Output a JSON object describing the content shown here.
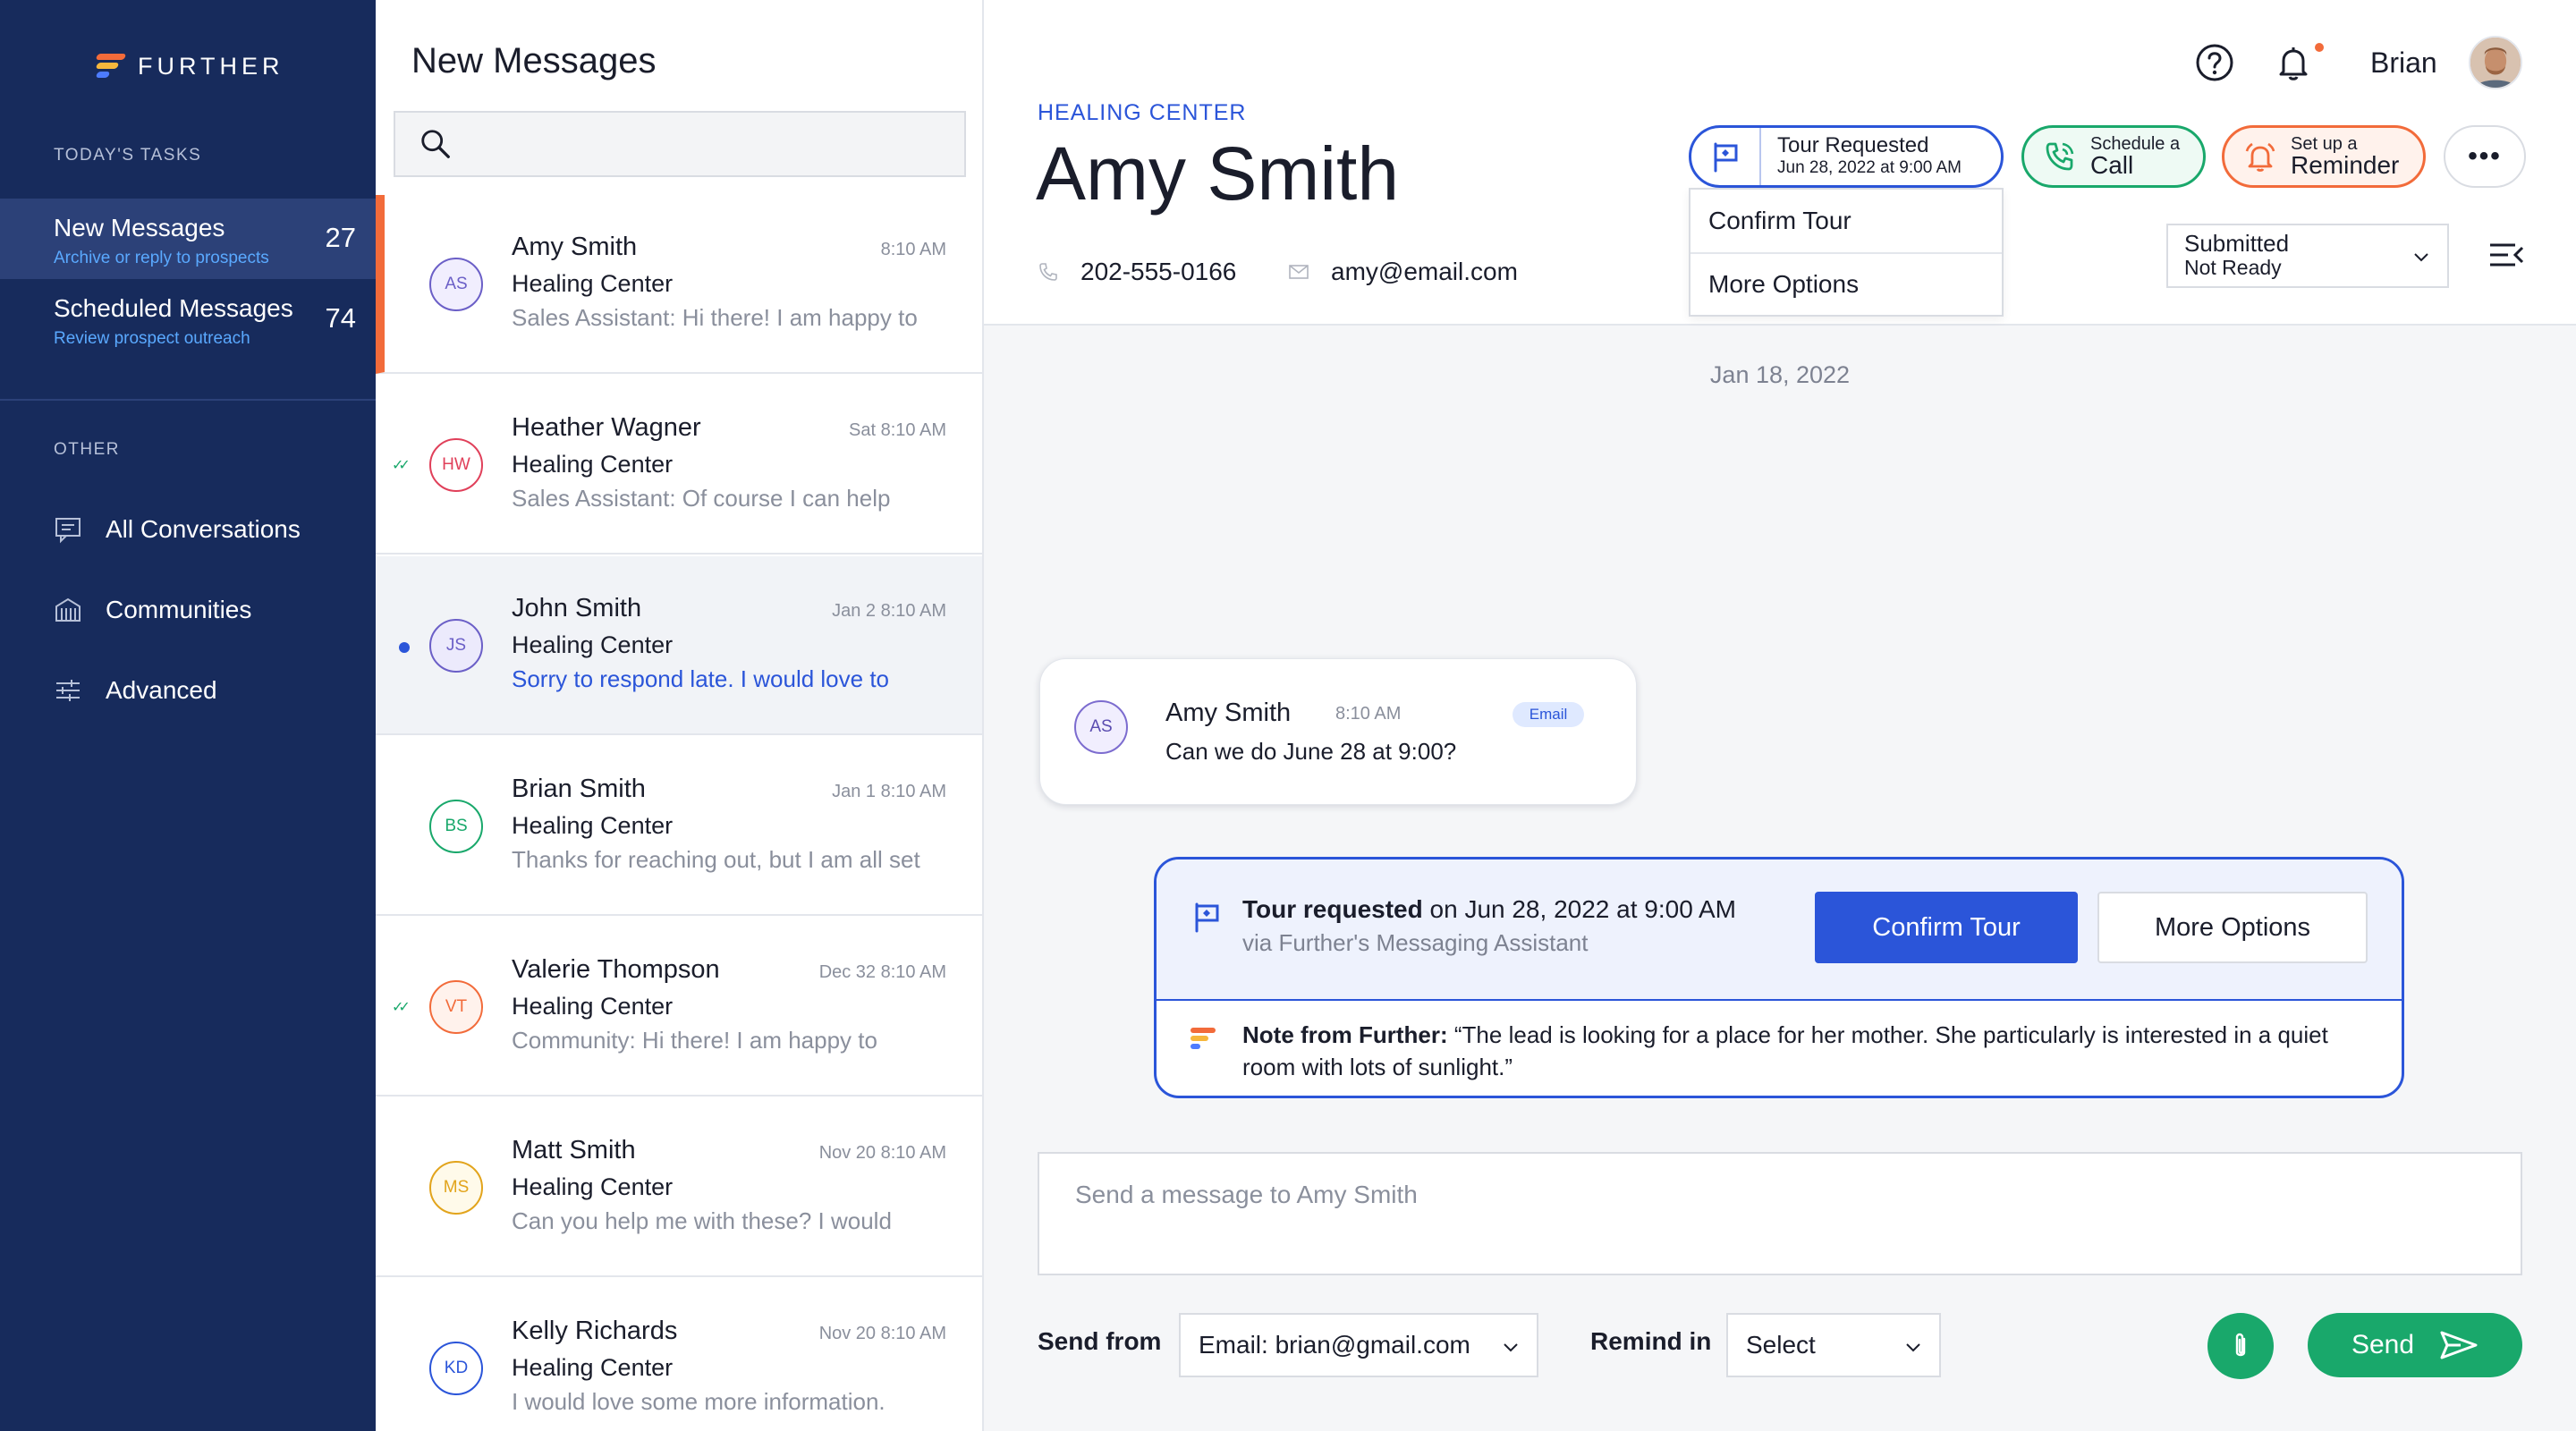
{
  "brand": {
    "name": "FURTHER"
  },
  "sidebar": {
    "todays_tasks_heading": "TODAY'S TASKS",
    "tasks": [
      {
        "title": "New Messages",
        "subtitle": "Archive or reply to prospects",
        "count": "27",
        "active": true
      },
      {
        "title": "Scheduled Messages",
        "subtitle": "Review prospect outreach",
        "count": "74",
        "active": false
      }
    ],
    "other_heading": "OTHER",
    "nav": [
      {
        "label": "All Conversations",
        "icon": "chat-icon"
      },
      {
        "label": "Communities",
        "icon": "building-icon"
      },
      {
        "label": "Advanced",
        "icon": "sliders-icon"
      }
    ]
  },
  "list": {
    "title": "New Messages",
    "search_placeholder": "",
    "conversations": [
      {
        "initials": "AS",
        "name": "Amy Smith",
        "org": "Healing Center",
        "preview": "Sales Assistant: Hi there! I am happy to",
        "time": "8:10 AM",
        "color": "#6b5fc7",
        "bg": "#f1eefe",
        "state": "selected"
      },
      {
        "initials": "HW",
        "name": "Heather Wagner",
        "org": "Healing Center",
        "preview": "Sales Assistant: Of course I can help",
        "time": "Sat 8:10 AM",
        "color": "#e0405a",
        "bg": "#ffffff",
        "state": "replied"
      },
      {
        "initials": "JS",
        "name": "John Smith",
        "org": "Healing Center",
        "preview": "Sorry to respond late. I would love to",
        "time": "Jan 2 8:10 AM",
        "color": "#6b5fc7",
        "bg": "#eceafc",
        "state": "unread"
      },
      {
        "initials": "BS",
        "name": "Brian Smith",
        "org": "Healing Center",
        "preview": "Thanks for reaching out, but I am all set",
        "time": "Jan 1 8:10 AM",
        "color": "#19a86b",
        "bg": "#ffffff",
        "state": "normal"
      },
      {
        "initials": "VT",
        "name": "Valerie Thompson",
        "org": "Healing Center",
        "preview": "Community: Hi there! I am happy to",
        "time": "Dec 32 8:10 AM",
        "color": "#f26b3a",
        "bg": "#fff2ec",
        "state": "replied"
      },
      {
        "initials": "MS",
        "name": "Matt Smith",
        "org": "Healing Center",
        "preview": "Can you help me with these? I would",
        "time": "Nov 20 8:10 AM",
        "color": "#e2a41c",
        "bg": "#fffaea",
        "state": "normal"
      },
      {
        "initials": "KD",
        "name": "Kelly Richards",
        "org": "Healing Center",
        "preview": "I would love some more information.",
        "time": "Nov 20 8:10 AM",
        "color": "#2b55d9",
        "bg": "#ffffff",
        "state": "normal"
      }
    ]
  },
  "header": {
    "org": "HEALING CENTER",
    "contact_name": "Amy Smith",
    "phone": "202-555-0166",
    "email": "amy@email.com",
    "user_name": "Brian",
    "tour": {
      "title": "Tour Requested",
      "date": "Jun 28, 2022 at 9:00 AM"
    },
    "tour_menu": [
      "Confirm Tour",
      "More Options"
    ],
    "call": {
      "small": "Schedule a",
      "big": "Call"
    },
    "reminder": {
      "small": "Set up a",
      "big": "Reminder"
    },
    "more": "•••",
    "status": {
      "line1": "Submitted",
      "line2": "Not Ready"
    }
  },
  "thread": {
    "date": "Jan 18, 2022",
    "message": {
      "initials": "AS",
      "name": "Amy Smith",
      "time": "8:10 AM",
      "channel": "Email",
      "text": "Can we do June 28 at 9:00?"
    },
    "tour_card": {
      "strong": "Tour requested",
      "rest": " on Jun 28, 2022 at 9:00 AM",
      "via": "via Further's Messaging Assistant",
      "confirm": "Confirm Tour",
      "more": "More Options",
      "note_label": "Note from Further:",
      "note_text": " “The lead is looking for a place for her mother. She particularly is interested in a quiet room with lots of sunlight.”"
    }
  },
  "composer": {
    "placeholder": "Send a message to Amy Smith",
    "send_from_label": "Send from",
    "send_from_value": "Email: brian@gmail.com",
    "remind_label": "Remind in",
    "remind_value": "Select",
    "send": "Send"
  },
  "colors": {
    "sidebar": "#172b5c",
    "accent": "#2b55d9",
    "green": "#19a86b",
    "orange": "#f26b3a"
  }
}
